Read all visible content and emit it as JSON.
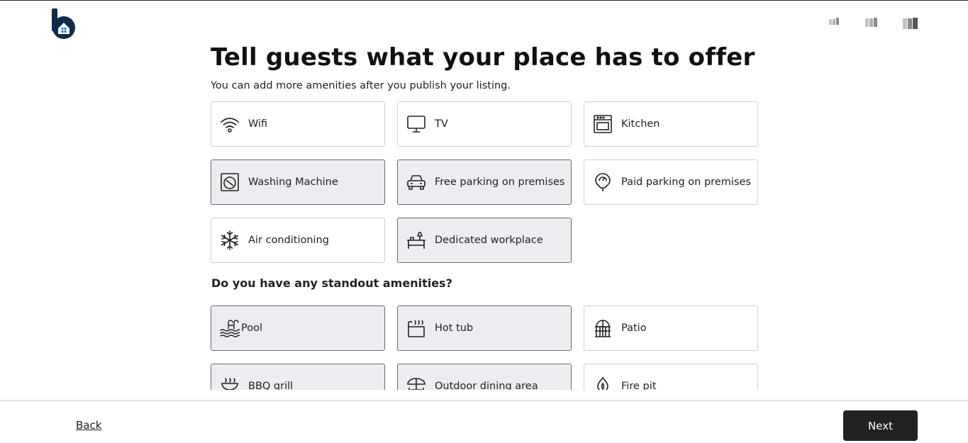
{
  "header": {
    "logo_icon": "house-b-logo",
    "brand_color": "#0d2c4a",
    "progress_steps": [
      "step-1",
      "step-2",
      "step-3"
    ]
  },
  "main": {
    "title": "Tell guests what your place has to offer",
    "subtitle": "You can add more amenities after you publish your listing.",
    "amenities": [
      {
        "label": "Wifi",
        "icon": "wifi-icon",
        "selected": false
      },
      {
        "label": "TV",
        "icon": "tv-icon",
        "selected": false
      },
      {
        "label": "Kitchen",
        "icon": "kitchen-icon",
        "selected": false
      },
      {
        "label": "Washing Machine",
        "icon": "washing-machine-icon",
        "selected": true
      },
      {
        "label": "Free parking on premises",
        "icon": "car-icon",
        "selected": true
      },
      {
        "label": "Paid parking on premises",
        "icon": "parking-meter-icon",
        "selected": false
      },
      {
        "label": "Air conditioning",
        "icon": "snowflake-icon",
        "selected": false
      },
      {
        "label": "Dedicated workplace",
        "icon": "desk-icon",
        "selected": true
      }
    ],
    "standout_title": "Do you have any standout amenities?",
    "standout": [
      {
        "label": "Pool",
        "icon": "pool-icon",
        "selected": true
      },
      {
        "label": "Hot tub",
        "icon": "hot-tub-icon",
        "selected": true
      },
      {
        "label": "Patio",
        "icon": "patio-icon",
        "selected": false
      },
      {
        "label": "BBQ grill",
        "icon": "grill-icon",
        "selected": true
      },
      {
        "label": "Outdoor dining area",
        "icon": "dining-table-icon",
        "selected": true
      },
      {
        "label": "Fire pit",
        "icon": "fire-pit-icon",
        "selected": false
      }
    ]
  },
  "footer": {
    "back_label": "Back",
    "next_label": "Next"
  }
}
